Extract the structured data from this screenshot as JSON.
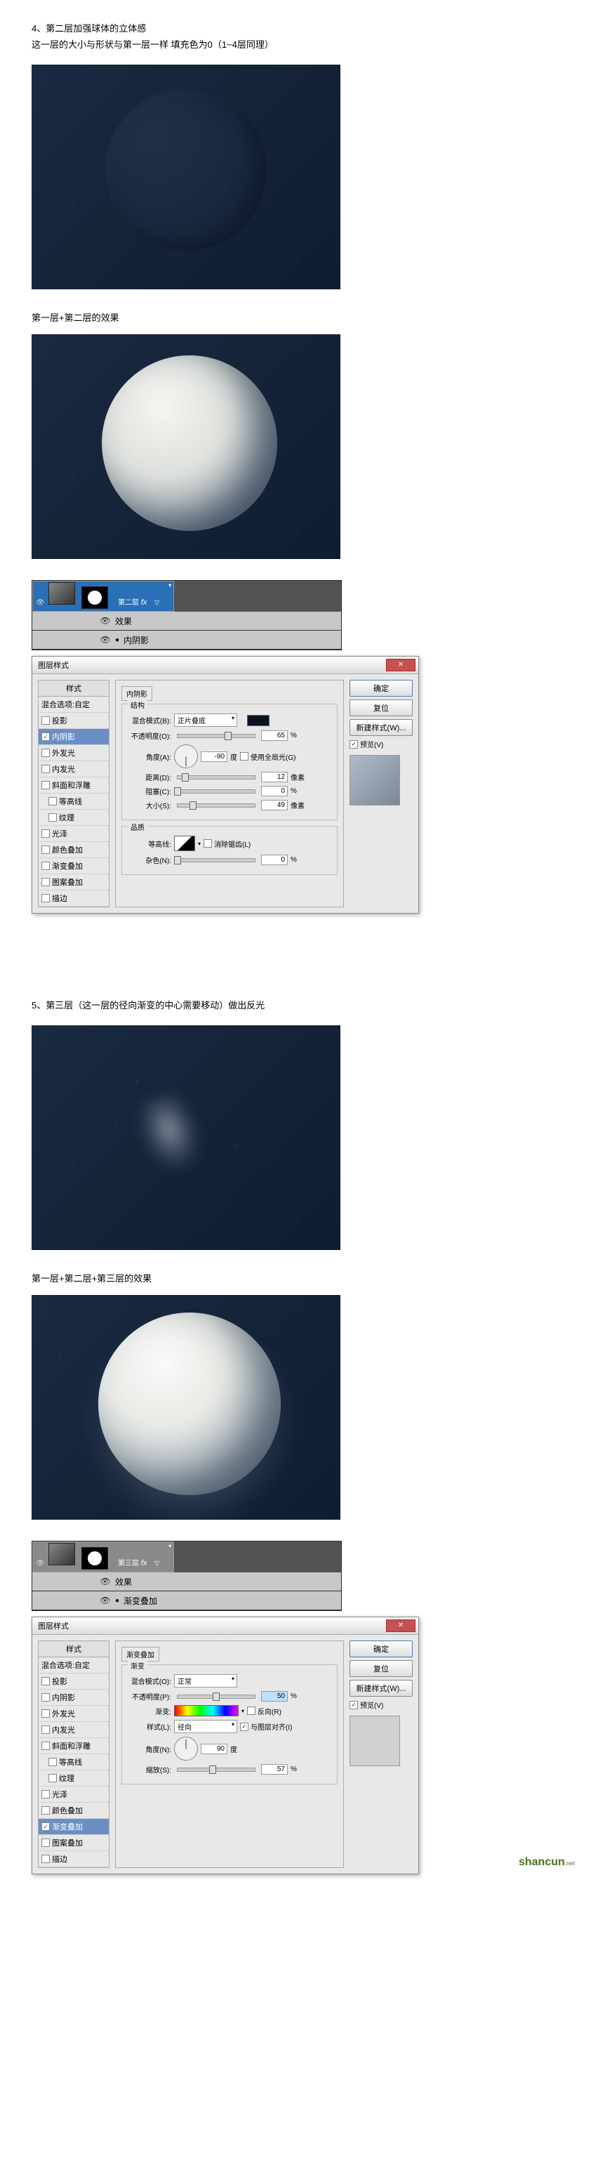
{
  "step4": {
    "num": "4、",
    "title": "第二层加强球体的立体感",
    "sub": "这一层的大小与形状与第一层一样  填充色为0（1~4层同理）",
    "caption1": "第一层+第二层的效果"
  },
  "step5": {
    "num": "5、",
    "title": "第三层（这一层的径向渐变的中心需要移动）做出反光",
    "caption1": "第一层+第二层+第三层的效果"
  },
  "layers2": {
    "layer_name": "第二层",
    "fx_label": "效果",
    "effect": "内阴影"
  },
  "layers3": {
    "layer_name": "第三层",
    "fx_label": "效果",
    "effect": "渐变叠加"
  },
  "dialog_title": "图层样式",
  "styles_header": "样式",
  "styles_list": {
    "blend": "混合选项:自定",
    "s1": "投影",
    "s2": "内阴影",
    "s3": "外发光",
    "s4": "内发光",
    "s5": "斜面和浮雕",
    "s5a": "等高线",
    "s5b": "纹理",
    "s6": "光泽",
    "s7": "颜色叠加",
    "s8": "渐变叠加",
    "s9": "图案叠加",
    "s10": "描边"
  },
  "dlg1": {
    "grp1_title": "内阴影",
    "grp_struct": "结构",
    "blend_label": "混合模式(B):",
    "blend_val": "正片叠底",
    "opacity_label": "不透明度(O):",
    "opacity_val": "65",
    "angle_label": "角度(A):",
    "angle_val": "-90",
    "angle_unit": "度",
    "global_light": "使用全局光(G)",
    "distance_label": "距离(D):",
    "distance_val": "12",
    "distance_unit": "像素",
    "choke_label": "阻塞(C):",
    "choke_val": "0",
    "size_label": "大小(S):",
    "size_val": "49",
    "size_unit": "像素",
    "grp_quality": "品质",
    "contour_label": "等高线:",
    "antialias": "消除锯齿(L)",
    "noise_label": "杂色(N):",
    "noise_val": "0"
  },
  "dlg2": {
    "grp1_title": "渐变叠加",
    "grp_grad": "渐变",
    "blend_label": "混合模式(O):",
    "blend_val": "正常",
    "opacity_label": "不透明度(P):",
    "opacity_val": "50",
    "gradient_label": "渐变:",
    "reverse": "反向(R)",
    "style_label": "样式(L):",
    "style_val": "径向",
    "align": "与图层对齐(I)",
    "angle_label": "角度(N):",
    "angle_val": "90",
    "angle_unit": "度",
    "scale_label": "缩放(S):",
    "scale_val": "57"
  },
  "buttons": {
    "ok": "确定",
    "cancel": "复位",
    "new_style": "新建样式(W)...",
    "preview": "预览(V)"
  },
  "pct": "%",
  "watermark": "shancun",
  "watermark_sub": ".net"
}
